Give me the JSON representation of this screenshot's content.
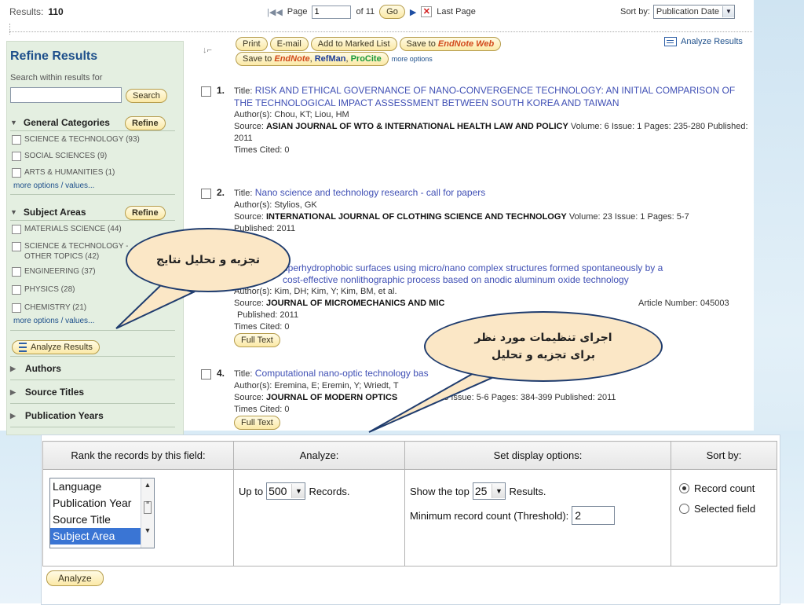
{
  "topbar": {
    "results_label": "Results:",
    "results_count": "110",
    "page_label": "Page",
    "page_value": "1",
    "of_pages": "of 11",
    "go_label": "Go",
    "last_page": "Last Page",
    "sort_label": "Sort by:",
    "sort_value": "Publication Date"
  },
  "toolbar": {
    "print": "Print",
    "email": "E-mail",
    "add_marked": "Add to Marked List",
    "save_to": "Save to",
    "endnote_web": "EndNote Web",
    "save_to2": "Save to",
    "endnote": "EndNote",
    "refman": "RefMan",
    "procite": "ProCite",
    "more_options": "more options",
    "analyze_results": "Analyze Results"
  },
  "sidebar": {
    "title": "Refine Results",
    "search_within": "Search within results for",
    "search_btn": "Search",
    "general_categories": "General Categories",
    "refine": "Refine",
    "gc_items": [
      "SCIENCE & TECHNOLOGY (93)",
      "SOCIAL SCIENCES (9)",
      "ARTS & HUMANITIES (1)"
    ],
    "more_options": "more options / values...",
    "subject_areas": "Subject Areas",
    "sa_items": [
      "MATERIALS SCIENCE (44)",
      "SCIENCE & TECHNOLOGY - OTHER TOPICS (42)",
      "ENGINEERING (37)",
      "PHYSICS (28)",
      "CHEMISTRY (21)"
    ],
    "analyze_results": "Analyze Results",
    "authors": "Authors",
    "source_titles": "Source Titles",
    "publication_years": "Publication Years"
  },
  "records": [
    {
      "num": "1.",
      "title_label": "Title:",
      "title": "RISK AND ETHICAL GOVERNANCE OF NANO-CONVERGENCE TECHNOLOGY: AN INITIAL COMPARISON OF THE TECHNOLOGICAL IMPACT ASSESSMENT BETWEEN SOUTH KOREA AND TAIWAN",
      "authors": "Author(s): Chou, KT; Liou, HM",
      "source_label": "Source:",
      "source": "ASIAN JOURNAL OF WTO & INTERNATIONAL HEALTH LAW AND POLICY",
      "volume": "Volume: 6  Issue: 1  Pages: 235-280  Published: 2011",
      "cited": "Times Cited: 0"
    },
    {
      "num": "2.",
      "title_label": "Title:",
      "title": "Nano science and technology research - call for papers",
      "authors": "Author(s): Stylios, GK",
      "source_label": "Source:",
      "source": "INTERNATIONAL JOURNAL OF CLOTHING SCIENCE AND TECHNOLOGY",
      "volume": "Volume: 23  Issue: 1  Pages: 5-7",
      "published": "Published: 2011"
    },
    {
      "title_tail": "uperhydrophobic surfaces using micro/nano complex structures formed spontaneously by a",
      "title_tail2": "cost-effective nonlithographic process based on anodic aluminum oxide technology",
      "authors": "Author(s): Kim, DH; Kim, Y; Kim, BM, et al.",
      "source_label": "Source:",
      "source": "JOURNAL OF MICROMECHANICS AND MIC",
      "article_number": "Article Number: 045003",
      "published": "Published: 2011",
      "cited": "Times Cited: 0",
      "full_text": "Full Text"
    },
    {
      "num": "4.",
      "title_label": "Title:",
      "title": "Computational nano-optic technology bas",
      "authors": "Author(s): Eremina, E; Eremin, Y; Wriedt, T",
      "source_label": "Source:",
      "source": "JOURNAL OF MODERN OPTICS",
      "volume": ".58  Issue: 5-6  Pages: 384-399  Published: 2011",
      "cited": "Times Cited: 0",
      "full_text": "Full Text"
    }
  ],
  "callouts": {
    "left": "تجزیه و تحلیل نتایج",
    "right_line1": "اجرای تنظیمات مورد نظر",
    "right_line2": "برای تجزیه و تحلیل"
  },
  "panel": {
    "col1": "Rank the records by this field:",
    "col2": "Analyze:",
    "col3": "Set display options:",
    "col4": "Sort by:",
    "fields": [
      "Language",
      "Publication Year",
      "Source Title",
      "Subject Area"
    ],
    "up_to": "Up to",
    "up_to_value": "500",
    "records": "Records.",
    "show_top": "Show the top",
    "show_top_value": "25",
    "results": "Results.",
    "min_label": "Minimum record count (Threshold):",
    "min_value": "2",
    "sort_record_count": "Record count",
    "sort_selected_field": "Selected field",
    "analyze_btn": "Analyze"
  },
  "colors": {
    "link": "#4050b5",
    "sidebar": "#e4efe1",
    "pill": "#fbe9a7",
    "callout": "#fbe7c6"
  }
}
